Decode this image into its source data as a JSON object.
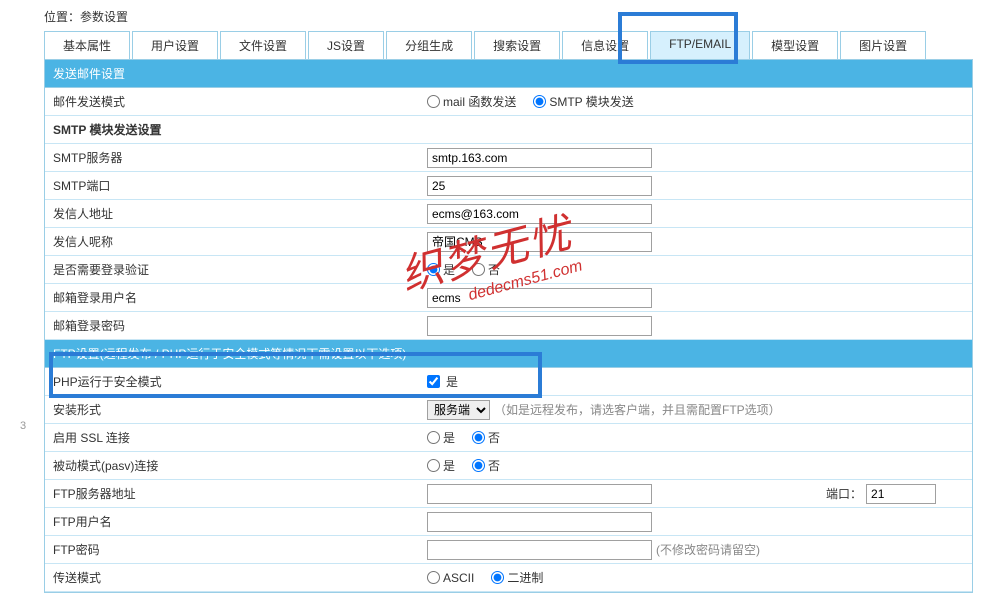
{
  "location_label": "位置：",
  "location_value": "参数设置",
  "tabs": [
    "基本属性",
    "用户设置",
    "文件设置",
    "JS设置",
    "分组生成",
    "搜索设置",
    "信息设置",
    "FTP/EMAIL",
    "模型设置",
    "图片设置"
  ],
  "section1_header": "发送邮件设置",
  "mail_mode_label": "邮件发送模式",
  "mail_mode_opt1": "mail 函数发送",
  "mail_mode_opt2": "SMTP 模块发送",
  "smtp_sub": "SMTP 模块发送设置",
  "smtp_server_label": "SMTP服务器",
  "smtp_server_value": "smtp.163.com",
  "smtp_port_label": "SMTP端口",
  "smtp_port_value": "25",
  "sender_addr_label": "发信人地址",
  "sender_addr_value": "ecms@163.com",
  "sender_nick_label": "发信人呢称",
  "sender_nick_value": "帝国CMS",
  "need_auth_label": "是否需要登录验证",
  "yes_label": "是",
  "no_label": "否",
  "login_user_label": "邮箱登录用户名",
  "login_user_value": "ecms",
  "login_pass_label": "邮箱登录密码",
  "section2_header": "FTP设置(远程发布 / PHP运行于安全模式等情况下需设置以下选项)",
  "safe_mode_label": "PHP运行于安全模式",
  "install_type_label": "安装形式",
  "install_type_opt": "服务端",
  "install_hint": "（如是远程发布，请选客户端，并且需配置FTP选项）",
  "ssl_label": "启用 SSL 连接",
  "pasv_label": "被动模式(pasv)连接",
  "ftp_server_label": "FTP服务器地址",
  "ftp_port_label": "端口：",
  "ftp_port_value": "21",
  "ftp_user_label": "FTP用户名",
  "ftp_pass_label": "FTP密码",
  "ftp_pass_hint": "(不修改密码请留空)",
  "transfer_label": "传送模式",
  "transfer_opt1": "ASCII",
  "transfer_opt2": "二进制",
  "watermark_main": "织梦无忧",
  "watermark_sub": "dedecms51.com",
  "page_num": "3"
}
